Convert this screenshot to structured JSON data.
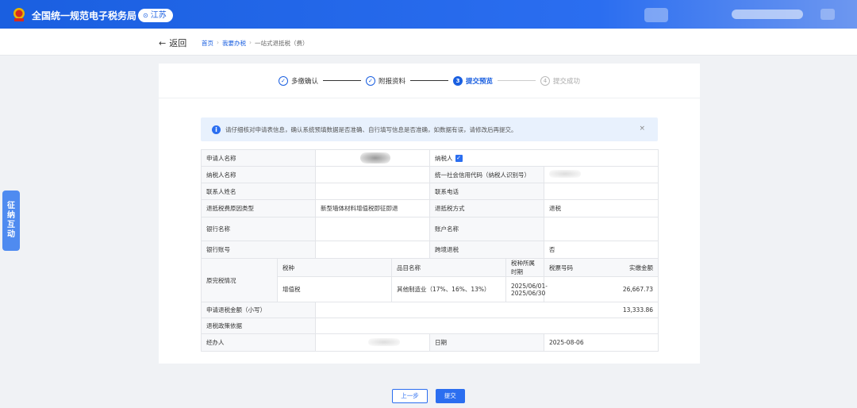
{
  "header": {
    "site_title": "全国统一规范电子税务局",
    "region": "江苏",
    "region_icon": "location-pin-icon"
  },
  "subheader": {
    "back_label": "返回",
    "breadcrumb": [
      "首页",
      "我要办税",
      "一站式退抵税（费）"
    ]
  },
  "steps": [
    {
      "num": "✓",
      "label": "多缴确认",
      "state": "done"
    },
    {
      "num": "✓",
      "label": "附报资料",
      "state": "done"
    },
    {
      "num": "3",
      "label": "提交预览",
      "state": "active"
    },
    {
      "num": "4",
      "label": "提交成功",
      "state": "todo"
    }
  ],
  "notice": {
    "text": "请仔细核对申请表信息，确认系统预填数据是否准确、自行填写信息是否准确，如数据有误，请修改后再提交。",
    "close": "×"
  },
  "form": {
    "applicant_name_label": "申请人名称",
    "taxpayer_label": "纳税人",
    "taxpayer_checked": true,
    "taxpayer_name_label": "纳税人名称",
    "credit_code_label": "统一社会信用代码（纳税人识别号）",
    "contact_name_label": "联系人姓名",
    "contact_phone_label": "联系电话",
    "refund_reason_type_label": "退抵税费原因类型",
    "refund_reason_type_value": "新型墙体材料增值税即征即退",
    "refund_method_label": "退抵税方式",
    "refund_method_value": "退税",
    "bank_name_label": "银行名称",
    "account_name_label": "账户名称",
    "bank_account_label": "银行账号",
    "cross_region_label": "跨境退税",
    "cross_region_value": "否",
    "original_tax_label": "原完税情况",
    "sub_headers": {
      "tax_type": "税种",
      "item_name": "品目名称",
      "period": "税种所属时期",
      "ticket_no": "税票号码",
      "paid_amount": "实缴金额"
    },
    "sub_row": {
      "tax_type": "增值税",
      "item_name": "其他制造业（17%、16%、13%）",
      "period": "2025/06/01-2025/06/30",
      "ticket_no": "",
      "paid_amount": "26,667.73"
    },
    "refund_amount_label": "申请退税金额（小写）",
    "refund_amount_value": "13,333.86",
    "policy_basis_label": "退税政策依据",
    "handler_label": "经办人",
    "date_label": "日期",
    "date_value": "2025-08-06"
  },
  "actions": {
    "prev_label": "上一步",
    "submit_label": "提交"
  },
  "side_float": [
    "征",
    "纳",
    "互",
    "动"
  ]
}
